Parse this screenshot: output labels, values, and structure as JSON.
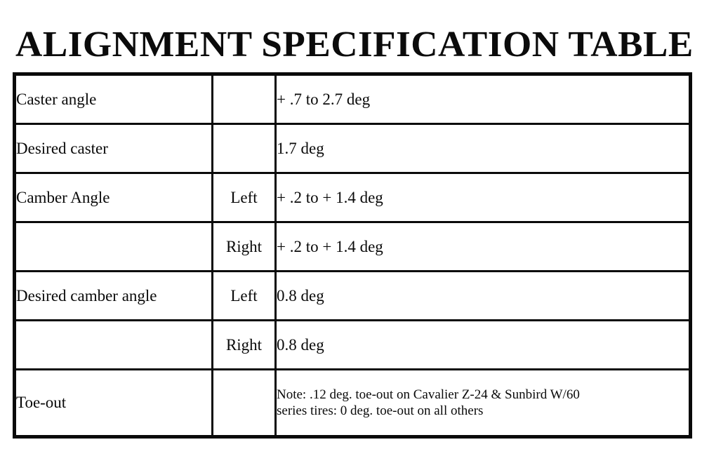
{
  "document": {
    "title": "ALIGNMENT SPECIFICATION TABLE",
    "background_color": "#ffffff",
    "text_color": "#0a0a0a",
    "border_color": "#0a0a0a"
  },
  "table": {
    "columns": [
      "parameter",
      "side",
      "value"
    ],
    "rows": [
      {
        "parameter": "Caster angle",
        "side": "",
        "value": "+ .7 to 2.7 deg",
        "height": "standard"
      },
      {
        "parameter": "Desired caster",
        "side": "",
        "value": "1.7 deg",
        "height": "standard"
      },
      {
        "parameter": "Camber Angle",
        "side": "Left",
        "value": "+ .2 to + 1.4 deg",
        "height": "standard"
      },
      {
        "parameter": "",
        "side": "Right",
        "value": "+ .2 to + 1.4 deg",
        "height": "standard"
      },
      {
        "parameter": "Desired camber angle",
        "side": "Left",
        "value": "0.8 deg",
        "height": "standard"
      },
      {
        "parameter": "",
        "side": "Right",
        "value": "0.8 deg",
        "height": "standard"
      },
      {
        "parameter": "Toe-out",
        "side": "",
        "value": "",
        "note_line_1": "Note: .12 deg. toe-out on Cavalier Z-24 & Sunbird W/60",
        "note_line_2": "series tires: 0 deg. toe-out on all others",
        "height": "tall"
      }
    ]
  }
}
